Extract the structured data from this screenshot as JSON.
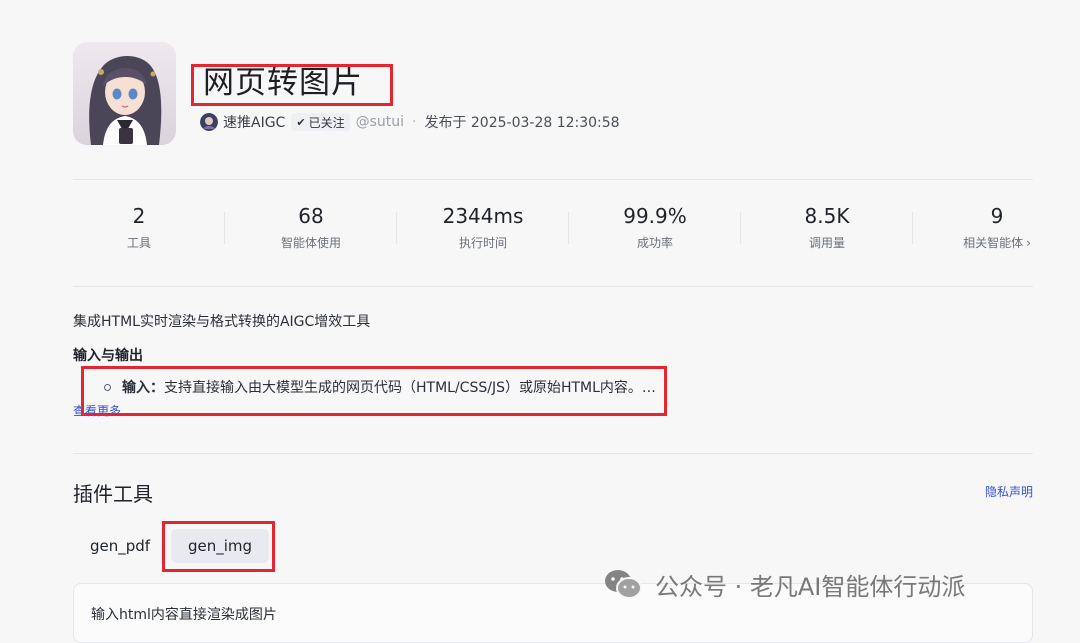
{
  "header": {
    "title": "网页转图片",
    "author": "速推AIGC",
    "follow_label": "已关注",
    "handle": "@sutui",
    "separator": "·",
    "published": "发布于 2025-03-28 12:30:58"
  },
  "stats": [
    {
      "value": "2",
      "label": "工具"
    },
    {
      "value": "68",
      "label": "智能体使用"
    },
    {
      "value": "2344ms",
      "label": "执行时间"
    },
    {
      "value": "99.9%",
      "label": "成功率"
    },
    {
      "value": "8.5K",
      "label": "调用量"
    },
    {
      "value": "9",
      "label": "相关智能体"
    }
  ],
  "description": {
    "summary": "集成HTML实时渲染与格式转换的AIGC增效工具",
    "section_label": "输入与输出",
    "bullet_key": "输入：",
    "bullet_text": "支持直接输入由大模型生成的网页代码（HTML/CSS/JS）或原始HTML内容。…",
    "more_link": "查看更多"
  },
  "plugins": {
    "title": "插件工具",
    "privacy_link": "隐私声明",
    "tabs": [
      {
        "label": "gen_pdf",
        "active": false
      },
      {
        "label": "gen_img",
        "active": true
      }
    ],
    "tool_description": "输入html内容直接渲染成图片"
  },
  "watermark": {
    "text": "公众号 · 老凡AI智能体行动派",
    "icon": "wechat-icon"
  },
  "colors": {
    "highlight_box": "#e3262f",
    "link": "#3450d6",
    "background": "#f7f7f8"
  }
}
